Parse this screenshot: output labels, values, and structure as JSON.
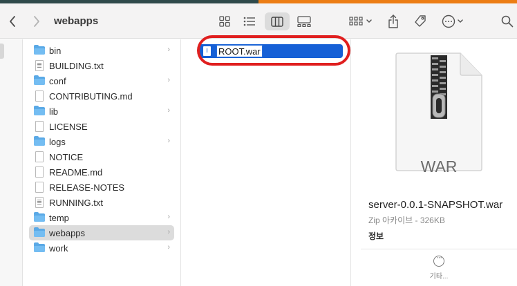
{
  "window": {
    "title": "webapps"
  },
  "toolbar": {
    "icons": [
      "chevron-left-icon",
      "chevron-right-icon",
      "icon-view-icon",
      "list-view-icon",
      "column-view-icon",
      "gallery-view-icon",
      "group-icon",
      "share-icon",
      "tag-icon",
      "more-icon",
      "search-icon"
    ],
    "active_view": "column"
  },
  "column1": {
    "items": [
      {
        "label": "bin",
        "kind": "folder",
        "has_children": true,
        "selected": false
      },
      {
        "label": "BUILDING.txt",
        "kind": "text",
        "has_children": false,
        "selected": false
      },
      {
        "label": "conf",
        "kind": "folder",
        "has_children": true,
        "selected": false
      },
      {
        "label": "CONTRIBUTING.md",
        "kind": "file",
        "has_children": false,
        "selected": false
      },
      {
        "label": "lib",
        "kind": "folder",
        "has_children": true,
        "selected": false
      },
      {
        "label": "LICENSE",
        "kind": "file",
        "has_children": false,
        "selected": false
      },
      {
        "label": "logs",
        "kind": "folder",
        "has_children": true,
        "selected": false
      },
      {
        "label": "NOTICE",
        "kind": "file",
        "has_children": false,
        "selected": false
      },
      {
        "label": "README.md",
        "kind": "file",
        "has_children": false,
        "selected": false
      },
      {
        "label": "RELEASE-NOTES",
        "kind": "file",
        "has_children": false,
        "selected": false
      },
      {
        "label": "RUNNING.txt",
        "kind": "text",
        "has_children": false,
        "selected": false
      },
      {
        "label": "temp",
        "kind": "folder",
        "has_children": true,
        "selected": false
      },
      {
        "label": "webapps",
        "kind": "folder",
        "has_children": true,
        "selected": true
      },
      {
        "label": "work",
        "kind": "folder",
        "has_children": true,
        "selected": false
      }
    ]
  },
  "column2": {
    "items": [
      {
        "label": "ROOT.war",
        "kind": "archive",
        "editing": true
      }
    ]
  },
  "preview": {
    "icon_label": "WAR",
    "filename": "server-0.0.1-SNAPSHOT.war",
    "meta": "Zip 아카이브 - 326KB",
    "info_heading": "정보",
    "more_label": "기타..."
  },
  "colors": {
    "accent": "#1660d6",
    "folder": "#5aa9e6",
    "annotation": "#e01f1f"
  },
  "chevron_glyph": "›"
}
